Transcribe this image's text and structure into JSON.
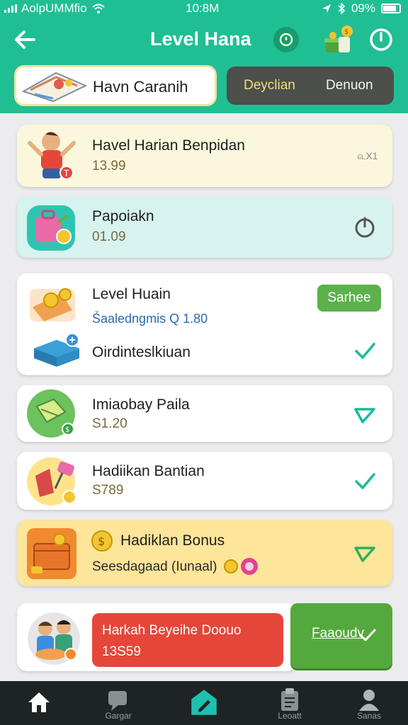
{
  "status_bar": {
    "carrier": "AolpUMMfio",
    "time": "10:8M",
    "battery": "09%",
    "icons": [
      "signal-bars-icon",
      "wifi-icon",
      "location-icon",
      "bluetooth-icon",
      "battery-icon"
    ]
  },
  "header": {
    "title": "Level Hana",
    "background_color": "#1fbf93",
    "icons": [
      "back-arrow-icon",
      "help-icon",
      "gift-coins-icon",
      "power-icon"
    ]
  },
  "tabs": [
    {
      "label": "Havn Caranih",
      "active": true
    },
    {
      "label": "Deyclian",
      "active": false
    },
    {
      "label": "Denuon",
      "active": false
    }
  ],
  "cards": [
    {
      "title": "Havel Harian Benpidan",
      "value": "13.99",
      "side": "௳X1",
      "background": "#fbf7dd",
      "icon": "person-icon"
    },
    {
      "title": "Papoiakn",
      "value": "01.09",
      "action": "power-icon",
      "background": "#d6f3ef",
      "icon": "suitcase-icon"
    },
    {
      "title": "Level Huain",
      "sub": "Ṥaaledngmis Q 1.80",
      "sub2": "Oirdinteslkiuan",
      "button": "Sarhee",
      "background": "#ffffff",
      "icon": "coins-icon"
    },
    {
      "title": "Imiaobay Paila",
      "value": "S1.20",
      "background": "#ffffff",
      "icon": "map-icon"
    },
    {
      "title": "Hadiikan Bantian",
      "value": "S789",
      "background": "#ffffff",
      "icon": "tag-icon"
    },
    {
      "title": "Hadiklan Bonus",
      "value": "Seesdagaad (Iunaal)",
      "background": "#fde59a",
      "icon": "chest-icon"
    }
  ],
  "bottom": {
    "red_button": {
      "line1": "Harkah Beyeihe Doouo",
      "line2": "13S59",
      "color": "#e4473a"
    },
    "green_button": {
      "label": "Faaoudv",
      "color": "#55a83c"
    }
  },
  "tabbar": [
    {
      "label": "",
      "icon": "home-icon",
      "active": true
    },
    {
      "label": "Gargar",
      "icon": "chat-icon"
    },
    {
      "label": "",
      "icon": "edit-icon",
      "active": true
    },
    {
      "label": "Leoatt",
      "icon": "clipboard-icon"
    },
    {
      "label": "Sanas",
      "icon": "profile-icon"
    }
  ],
  "colors": {
    "accent": "#1fbf93",
    "check": "#19b99a",
    "pill": "#5db14c"
  }
}
